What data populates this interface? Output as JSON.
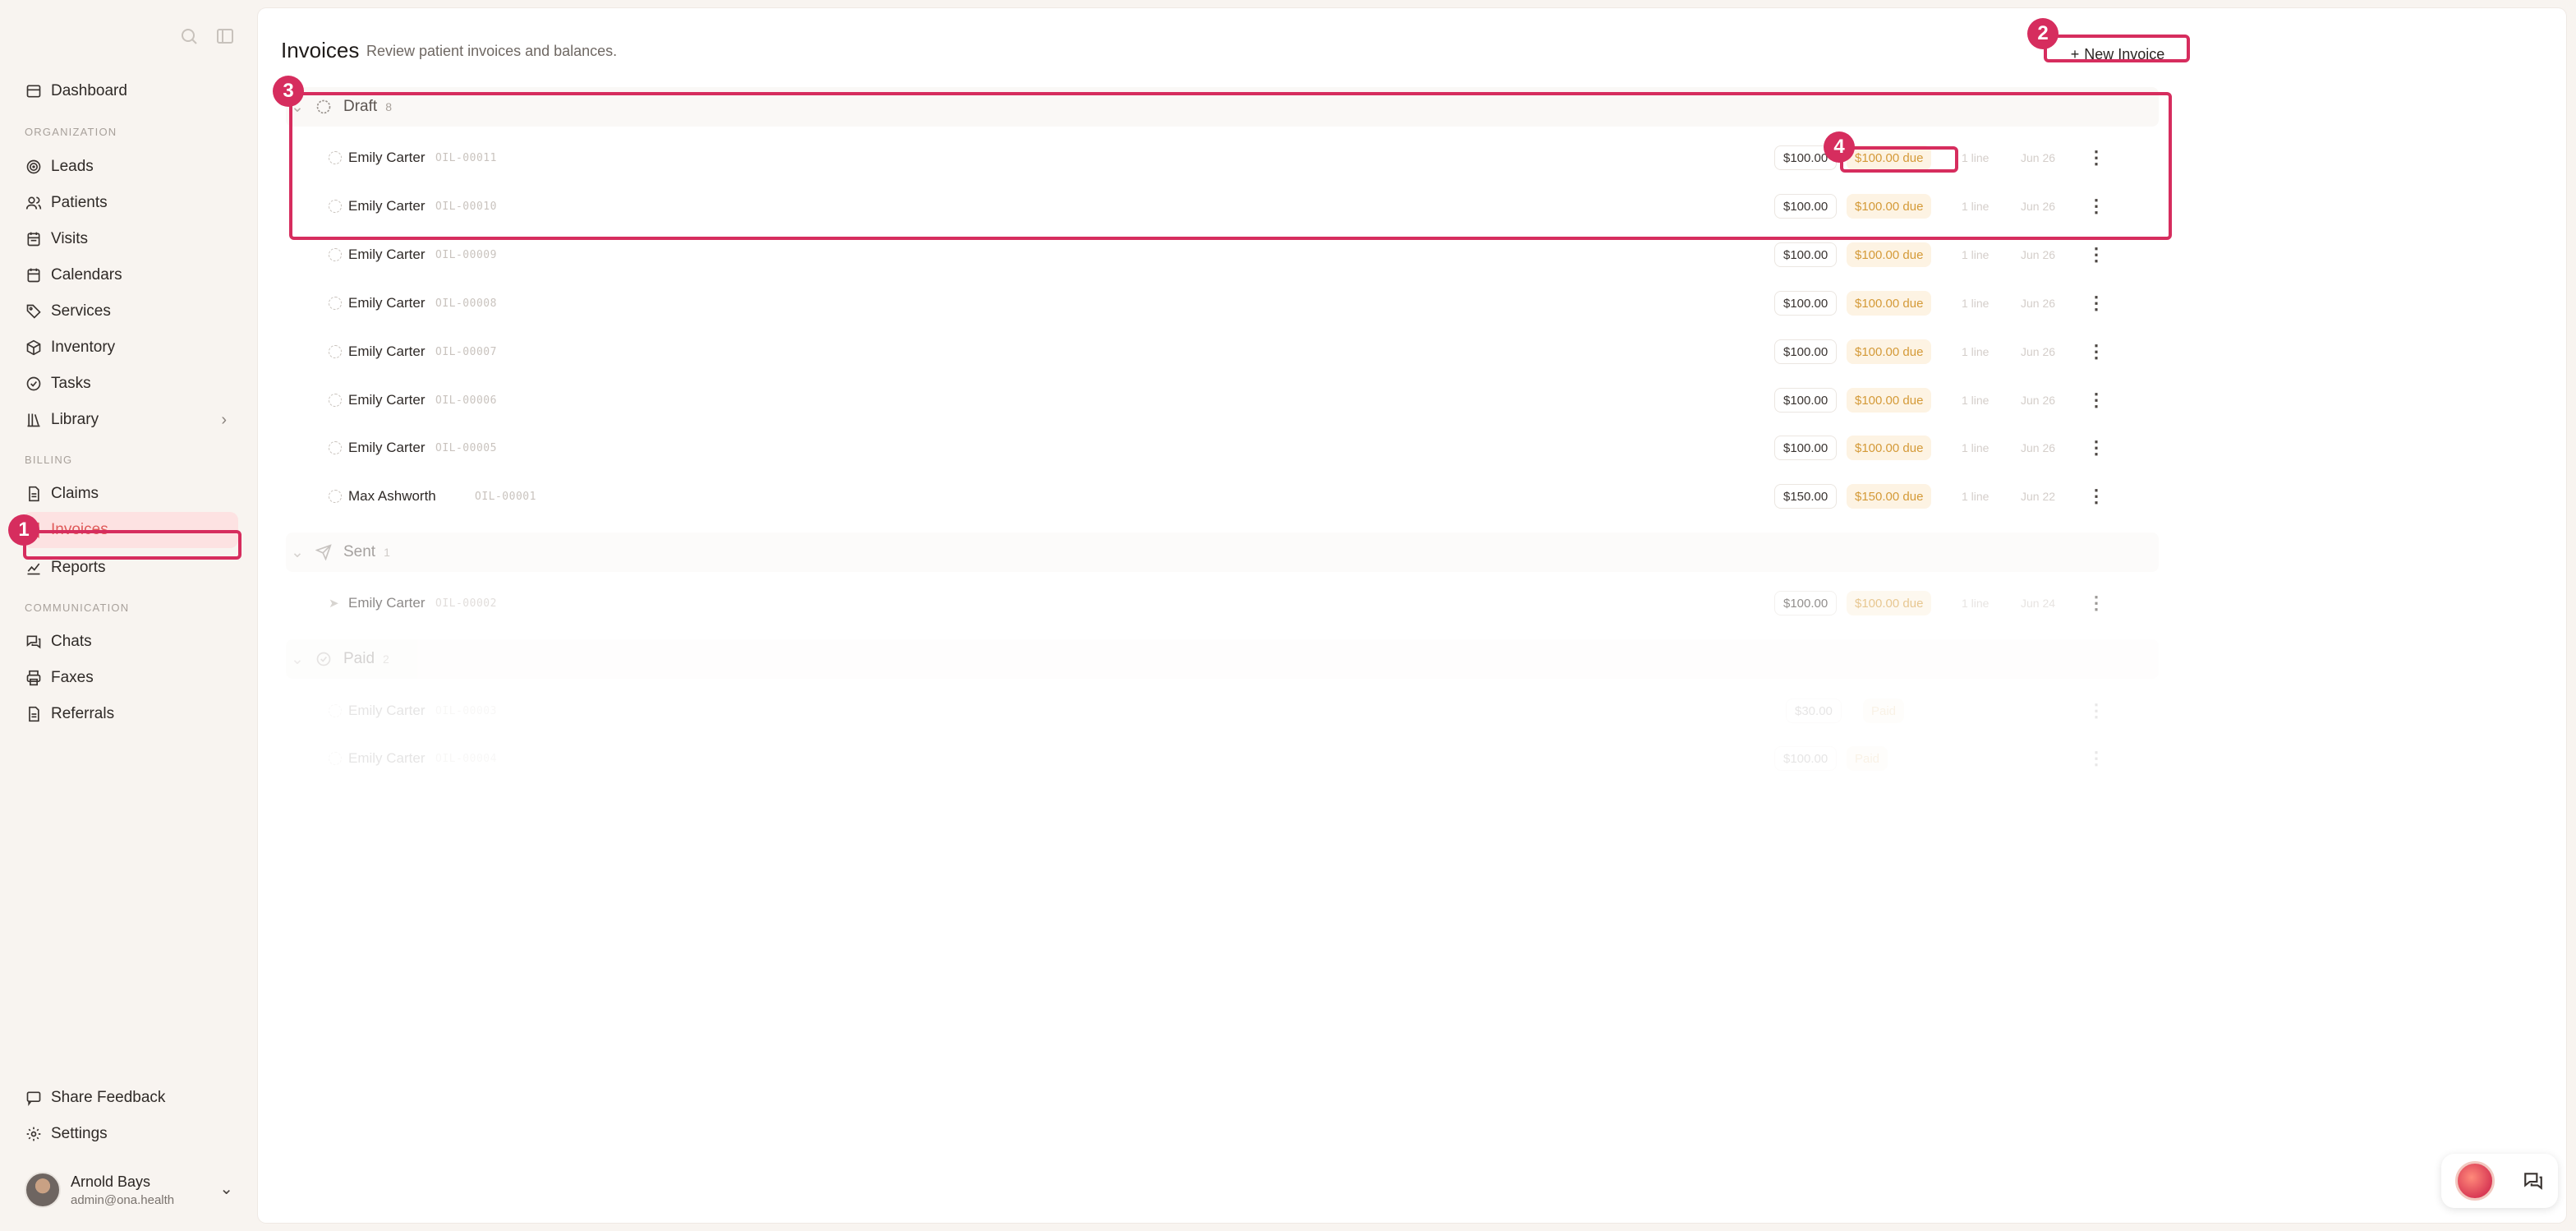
{
  "sidebar": {
    "nav": [
      {
        "label": "Dashboard",
        "icon": "dashboard-icon"
      },
      {
        "label": "Leads",
        "icon": "target-icon"
      },
      {
        "label": "Patients",
        "icon": "users-icon"
      },
      {
        "label": "Visits",
        "icon": "calendar-list-icon"
      },
      {
        "label": "Calendars",
        "icon": "calendar-icon"
      },
      {
        "label": "Services",
        "icon": "tag-icon"
      },
      {
        "label": "Inventory",
        "icon": "box-icon"
      },
      {
        "label": "Tasks",
        "icon": "check-circle-icon"
      },
      {
        "label": "Library",
        "icon": "library-icon"
      },
      {
        "label": "Claims",
        "icon": "document-icon"
      },
      {
        "label": "Invoices",
        "icon": "receipt-icon"
      },
      {
        "label": "Reports",
        "icon": "chart-icon"
      },
      {
        "label": "Chats",
        "icon": "chat-icon"
      },
      {
        "label": "Faxes",
        "icon": "printer-icon"
      },
      {
        "label": "Referrals",
        "icon": "document-icon"
      },
      {
        "label": "Share Feedback",
        "icon": "feedback-icon"
      },
      {
        "label": "Settings",
        "icon": "gear-icon"
      }
    ],
    "sections": {
      "organization": "ORGANIZATION",
      "billing": "BILLING",
      "communication": "COMMUNICATION"
    },
    "user": {
      "name": "Arnold Bays",
      "email": "admin@ona.health"
    }
  },
  "header": {
    "title": "Invoices",
    "subtitle": "Review patient invoices and balances.",
    "new_invoice_label": "New Invoice"
  },
  "groups": [
    {
      "label": "Draft",
      "count": "8"
    },
    {
      "label": "Sent",
      "count": "1"
    },
    {
      "label": "Paid",
      "count": "2"
    }
  ],
  "rows": [
    {
      "name": "Emily Carter",
      "code": "OIL-00011",
      "amount": "$100.00",
      "due": "$100.00 due",
      "lines": "1 line",
      "date": "Jun 26"
    },
    {
      "name": "Emily Carter",
      "code": "OIL-00010",
      "amount": "$100.00",
      "due": "$100.00 due",
      "lines": "1 line",
      "date": "Jun 26"
    },
    {
      "name": "Emily Carter",
      "code": "OIL-00009",
      "amount": "$100.00",
      "due": "$100.00 due",
      "lines": "1 line",
      "date": "Jun 26"
    },
    {
      "name": "Emily Carter",
      "code": "OIL-00008",
      "amount": "$100.00",
      "due": "$100.00 due",
      "lines": "1 line",
      "date": "Jun 26"
    },
    {
      "name": "Emily Carter",
      "code": "OIL-00007",
      "amount": "$100.00",
      "due": "$100.00 due",
      "lines": "1 line",
      "date": "Jun 26"
    },
    {
      "name": "Emily Carter",
      "code": "OIL-00006",
      "amount": "$100.00",
      "due": "$100.00 due",
      "lines": "1 line",
      "date": "Jun 26"
    },
    {
      "name": "Emily Carter",
      "code": "OIL-00005",
      "amount": "$100.00",
      "due": "$100.00 due",
      "lines": "1 line",
      "date": "Jun 26"
    },
    {
      "name": "Max Ashworth",
      "code": "OIL-00001",
      "amount": "$150.00",
      "due": "$150.00 due",
      "lines": "1 line",
      "date": "Jun 22"
    },
    {
      "name": "Emily Carter",
      "code": "OIL-00002",
      "amount": "$100.00",
      "due": "$100.00 due",
      "lines": "1 line",
      "date": "Jun 24"
    },
    {
      "name": "Emily Carter",
      "code": "OIL-00003",
      "amount": "$30.00",
      "due": "Paid",
      "lines": "",
      "date": ""
    },
    {
      "name": "Emily Carter",
      "code": "OIL-00004",
      "amount": "$100.00",
      "due": "Paid",
      "lines": "",
      "date": ""
    }
  ],
  "annotations": [
    "1",
    "2",
    "3",
    "4"
  ],
  "colors": {
    "accent": "#e05a5a",
    "annotation": "#d62d5e",
    "due_text": "#d49a38",
    "due_bg": "#fdf3e3"
  }
}
